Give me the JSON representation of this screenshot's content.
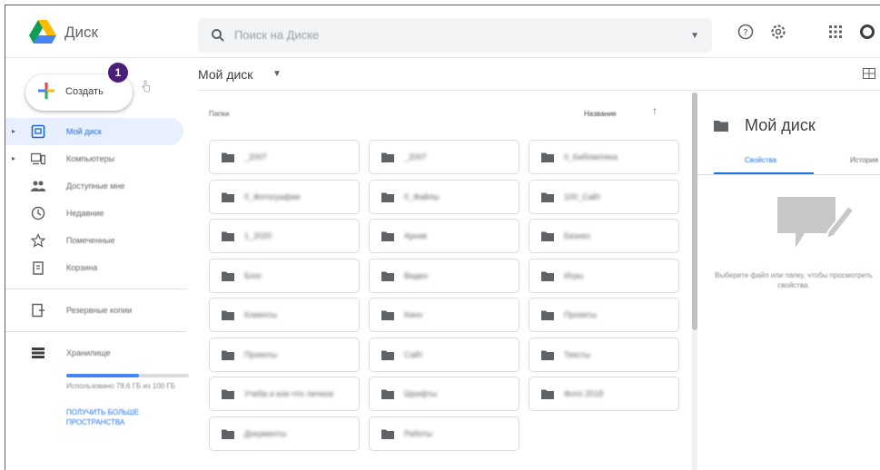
{
  "app": {
    "brand": "Диск",
    "accent_color": "#1a73e8"
  },
  "search": {
    "placeholder": "Поиск на Диске",
    "options_icon": "caret-down-icon"
  },
  "header_icons": [
    {
      "name": "help-icon"
    },
    {
      "name": "settings-icon"
    },
    {
      "name": "apps-grid-icon"
    },
    {
      "name": "account-icon"
    }
  ],
  "sidebar": {
    "create_label": "Создать",
    "step_badge": "1",
    "items": [
      {
        "label": "Мой диск",
        "icon": "my-drive-icon",
        "expandable": true,
        "active": true
      },
      {
        "label": "Компьютеры",
        "icon": "computers-icon",
        "expandable": true,
        "active": false
      },
      {
        "label": "Доступные мне",
        "icon": "shared-icon",
        "expandable": false,
        "active": false
      },
      {
        "label": "Недавние",
        "icon": "recent-icon",
        "expandable": false,
        "active": false
      },
      {
        "label": "Помеченные",
        "icon": "starred-icon",
        "expandable": false,
        "active": false
      },
      {
        "label": "Корзина",
        "icon": "trash-icon",
        "expandable": false,
        "active": false
      }
    ],
    "backups_label": "Резервные копии",
    "storage_label": "Хранилище",
    "storage_used_fraction": 0.59,
    "storage_text": "Использовано 78,6 ГБ из 100 ГБ",
    "storage_link": "ПОЛУЧИТЬ БОЛЬШЕ ПРОСТРАНСТВА"
  },
  "breadcrumb": {
    "title": "Мой диск"
  },
  "main": {
    "folders_label": "Папки",
    "sort_label": "Название",
    "folders": [
      {
        "name": "_2007"
      },
      {
        "name": "_2007"
      },
      {
        "name": "0_Библиотека"
      },
      {
        "name": "0_Фотографии"
      },
      {
        "name": "0_Файлы"
      },
      {
        "name": "100_Сайт"
      },
      {
        "name": "1_2020"
      },
      {
        "name": "Архив"
      },
      {
        "name": "Бизнес"
      },
      {
        "name": "Блог"
      },
      {
        "name": "Видео"
      },
      {
        "name": "Игры"
      },
      {
        "name": "Клиенты"
      },
      {
        "name": "Кино"
      },
      {
        "name": "Проекты"
      },
      {
        "name": "Проекты"
      },
      {
        "name": "Сайт"
      },
      {
        "name": "Тексты"
      },
      {
        "name": "Учеба и кое-что личное"
      },
      {
        "name": "Шрифты"
      },
      {
        "name": "Фото 2018"
      },
      {
        "name": "Документы"
      },
      {
        "name": "Работы"
      }
    ]
  },
  "details": {
    "title": "Мой диск",
    "tabs": [
      "Свойства",
      "История"
    ],
    "hint": "Выберите файл или папку, чтобы просмотреть свойства."
  }
}
